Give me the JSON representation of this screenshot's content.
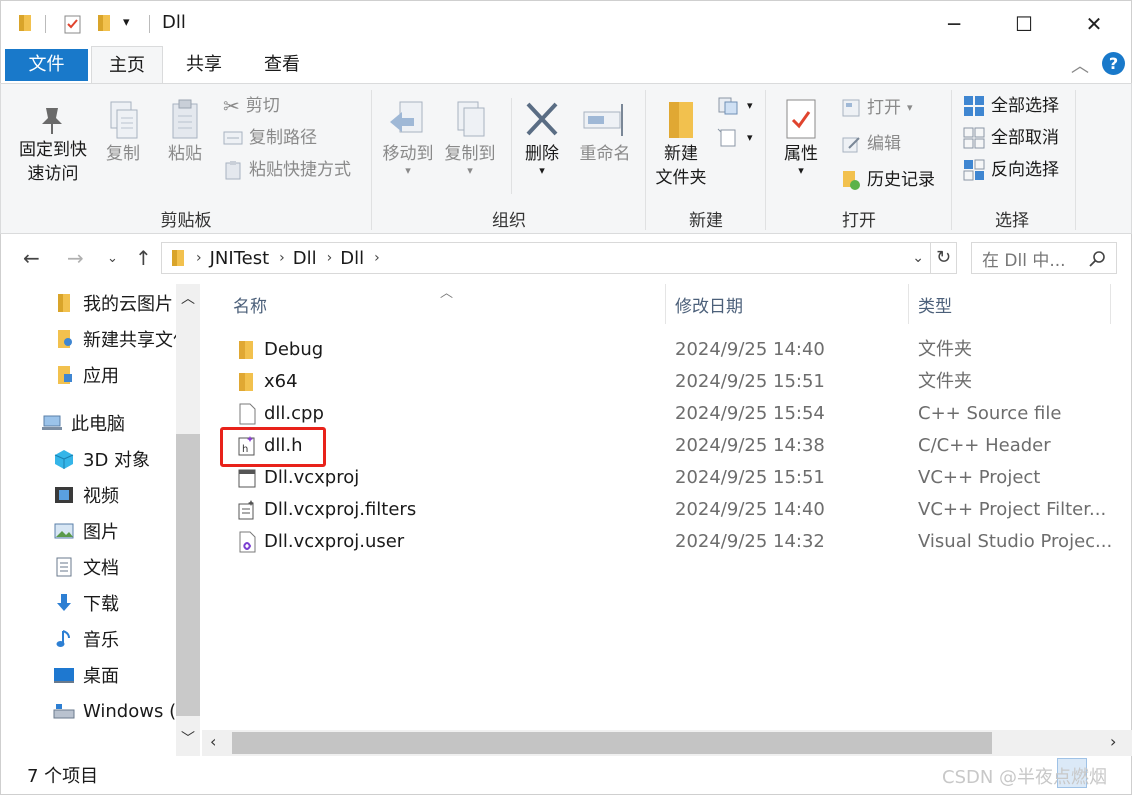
{
  "window": {
    "title": "Dll",
    "minimize": "─",
    "maximize": "☐",
    "close": "✕"
  },
  "tabs": [
    {
      "label": "文件"
    },
    {
      "label": "主页"
    },
    {
      "label": "共享"
    },
    {
      "label": "查看"
    }
  ],
  "ribbon": {
    "clipboard": {
      "pin_label_1": "固定到快",
      "pin_label_2": "速访问",
      "copy": "复制",
      "paste": "粘贴",
      "cut": "剪切",
      "copy_path": "复制路径",
      "paste_shortcut": "粘贴快捷方式",
      "group": "剪贴板"
    },
    "organize": {
      "move_to": "移动到",
      "copy_to": "复制到",
      "delete": "删除",
      "rename": "重命名",
      "group": "组织"
    },
    "new": {
      "new_folder_1": "新建",
      "new_folder_2": "文件夹",
      "group": "新建"
    },
    "open": {
      "properties": "属性",
      "open": "打开",
      "edit": "编辑",
      "history": "历史记录",
      "group": "打开"
    },
    "select": {
      "select_all": "全部选择",
      "select_none": "全部取消",
      "invert": "反向选择",
      "group": "选择"
    }
  },
  "address": {
    "crumbs": [
      "JNITest",
      "Dll",
      "Dll"
    ],
    "search_placeholder": "在 Dll 中..."
  },
  "nav": [
    {
      "label": "我的云图片",
      "icon": "folder-icon"
    },
    {
      "label": "新建共享文件",
      "icon": "shared-folder-icon"
    },
    {
      "label": "应用",
      "icon": "app-folder-icon"
    },
    {
      "label": "此电脑",
      "icon": "pc-icon"
    },
    {
      "label": "3D 对象",
      "icon": "3d-objects-icon"
    },
    {
      "label": "视频",
      "icon": "videos-icon"
    },
    {
      "label": "图片",
      "icon": "pictures-icon"
    },
    {
      "label": "文档",
      "icon": "documents-icon"
    },
    {
      "label": "下载",
      "icon": "downloads-icon"
    },
    {
      "label": "音乐",
      "icon": "music-icon"
    },
    {
      "label": "桌面",
      "icon": "desktop-icon"
    },
    {
      "label": "Windows (C",
      "icon": "drive-icon"
    }
  ],
  "columns": {
    "name": "名称",
    "date": "修改日期",
    "type": "类型"
  },
  "files": [
    {
      "name": "Debug",
      "date": "2024/9/25 14:40",
      "type": "文件夹",
      "icon": "folder-icon"
    },
    {
      "name": "x64",
      "date": "2024/9/25 15:51",
      "type": "文件夹",
      "icon": "folder-icon"
    },
    {
      "name": "dll.cpp",
      "date": "2024/9/25 15:54",
      "type": "C++ Source file",
      "icon": "cpp-file-icon"
    },
    {
      "name": "dll.h",
      "date": "2024/9/25 14:38",
      "type": "C/C++ Header",
      "icon": "header-file-icon"
    },
    {
      "name": "Dll.vcxproj",
      "date": "2024/9/25 15:51",
      "type": "VC++ Project",
      "icon": "vcxproj-icon"
    },
    {
      "name": "Dll.vcxproj.filters",
      "date": "2024/9/25 14:40",
      "type": "VC++ Project Filter...",
      "icon": "filters-icon"
    },
    {
      "name": "Dll.vcxproj.user",
      "date": "2024/9/25 14:32",
      "type": "Visual Studio Projec...",
      "icon": "user-file-icon"
    }
  ],
  "status": {
    "count": "7 个项目"
  },
  "watermark": "CSDN @半夜点燃烟",
  "colors": {
    "accent": "#1979ca",
    "highlight": "#e8221a",
    "folder": "#f2c14e"
  }
}
